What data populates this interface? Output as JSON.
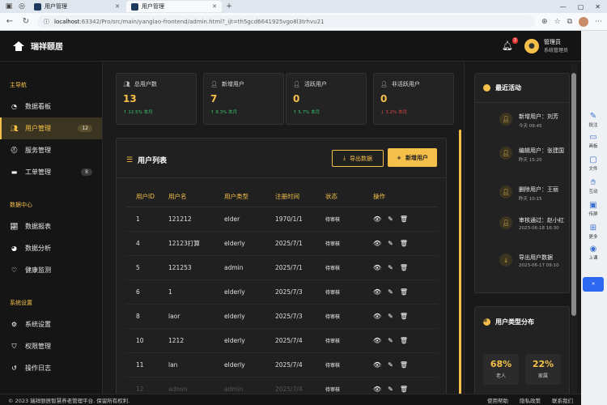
{
  "browser": {
    "tabs": [
      {
        "title": "用户管理",
        "active": false
      },
      {
        "title": "用户管理",
        "active": true
      }
    ],
    "url_host": "localhost",
    "url_path": ":63342/Pro/src/main/yanglao-frontend/admin.html?_ijt=th5gcd6641925vgo8l3trhvu21",
    "new_tab": "+",
    "window_controls": [
      "—",
      "▢",
      "✕"
    ]
  },
  "app": {
    "title": "瑞祥颐居",
    "notification_count": "3",
    "user_name": "管理员",
    "user_role": "系统管理员"
  },
  "sidebar": {
    "sections": [
      {
        "title": "主导航",
        "items": [
          {
            "label": "数据看板",
            "icon": "dashboard-icon",
            "count": ""
          },
          {
            "label": "用户管理",
            "icon": "users-icon",
            "count": "12",
            "active": true
          },
          {
            "label": "服务管理",
            "icon": "service-icon",
            "count": ""
          },
          {
            "label": "工单管理",
            "icon": "ticket-icon",
            "count": "8"
          }
        ]
      },
      {
        "title": "数据中心",
        "items": [
          {
            "label": "数据报表",
            "icon": "chart-icon",
            "count": ""
          },
          {
            "label": "数据分析",
            "icon": "pie-icon",
            "count": ""
          },
          {
            "label": "健康监测",
            "icon": "heartbeat-icon",
            "count": ""
          }
        ]
      },
      {
        "title": "系统设置",
        "items": [
          {
            "label": "系统设置",
            "icon": "gear-icon",
            "count": ""
          },
          {
            "label": "权限管理",
            "icon": "shield-icon",
            "count": ""
          },
          {
            "label": "操作日志",
            "icon": "history-icon",
            "count": ""
          }
        ]
      }
    ]
  },
  "stats": [
    {
      "label": "总用户数",
      "value": "13",
      "trend": "↑ 12.5% 本月",
      "dir": "up"
    },
    {
      "label": "新增用户",
      "value": "7",
      "trend": "↑ 8.3% 本月",
      "dir": "up"
    },
    {
      "label": "活跃用户",
      "value": "0",
      "trend": "↑ 5.7% 本月",
      "dir": "up"
    },
    {
      "label": "非活跃用户",
      "value": "0",
      "trend": "↓ 3.2% 本月",
      "dir": "down"
    }
  ],
  "user_table": {
    "title": "用户列表",
    "export_label": "导出数据",
    "add_label": "新增用户",
    "columns": [
      "用户ID",
      "用户名",
      "用户类型",
      "注册时间",
      "状态",
      "操作"
    ],
    "rows": [
      [
        "1",
        "121212",
        "elder",
        "1970/1/1",
        "待审核"
      ],
      [
        "4",
        "12123打算",
        "elderly",
        "2025/7/1",
        "待审核"
      ],
      [
        "5",
        "121253",
        "admin",
        "2025/7/1",
        "待审核"
      ],
      [
        "6",
        "1",
        "elderly",
        "2025/7/3",
        "待审核"
      ],
      [
        "8",
        "laor",
        "elderly",
        "2025/7/3",
        "待审核"
      ],
      [
        "10",
        "1212",
        "elderly",
        "2025/7/4",
        "待审核"
      ],
      [
        "11",
        "lan",
        "elderly",
        "2025/7/4",
        "待审核"
      ],
      [
        "12",
        "admin",
        "admin",
        "2025/7/4",
        "待审核"
      ]
    ]
  },
  "recent": {
    "title": "最近活动",
    "items": [
      {
        "text": "新增用户：刘芳",
        "time": "今天 09:45",
        "icon": "user-plus-icon"
      },
      {
        "text": "编辑用户：张建国",
        "time": "昨天 15:20",
        "icon": "user-edit-icon"
      },
      {
        "text": "删除用户：王丽",
        "time": "昨天 10:15",
        "icon": "user-remove-icon"
      },
      {
        "text": "审核通过：赵小红",
        "time": "2023-06-18 16:30",
        "icon": "user-check-icon"
      },
      {
        "text": "导出用户数据",
        "time": "2023-06-17 09:10",
        "icon": "export-icon"
      }
    ]
  },
  "distribution": {
    "title": "用户类型分布",
    "items": [
      {
        "pct": "68%",
        "label": "老人"
      },
      {
        "pct": "22%",
        "label": "家属"
      }
    ]
  },
  "footer": {
    "copyright": "© 2023 瑞祥颐居智慧养老管理平台. 保留所有权利.",
    "links": [
      "使用帮助",
      "隐私政策",
      "联系我们"
    ]
  },
  "edge_sidebar": [
    "批注",
    "画板",
    "文件",
    "互动",
    "传屏",
    "更多",
    "上课"
  ],
  "colors": {
    "accent": "#f5c04a",
    "bg": "#1b1b1b",
    "up": "#39c26b",
    "down": "#e04848"
  }
}
